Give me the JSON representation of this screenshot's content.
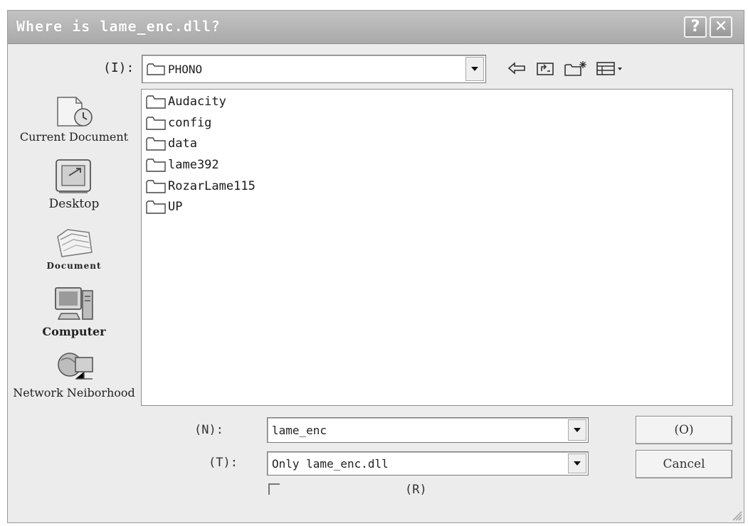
{
  "window": {
    "title": "Where is lame_enc.dll?",
    "help_glyph": "?",
    "close_glyph": "✕"
  },
  "look_in": {
    "label": "(I):",
    "value": "PHONO"
  },
  "toolbar": {
    "icons": [
      "back-arrow-icon",
      "up-folder-icon",
      "new-folder-icon",
      "view-menu-icon"
    ]
  },
  "places": [
    {
      "label": "Current Document",
      "icon": "recent-documents-icon"
    },
    {
      "label": "Desktop",
      "icon": "desktop-icon"
    },
    {
      "label": "Document",
      "icon": "my-documents-icon"
    },
    {
      "label": "Computer",
      "icon": "computer-icon"
    },
    {
      "label": "Network Neiborhood",
      "icon": "network-icon"
    }
  ],
  "files": [
    {
      "name": "Audacity"
    },
    {
      "name": "config"
    },
    {
      "name": "data"
    },
    {
      "name": "lame392"
    },
    {
      "name": "RozarLame115"
    },
    {
      "name": "UP"
    }
  ],
  "filename": {
    "label": "(N):",
    "value": "lame_enc"
  },
  "filetype": {
    "label": "(T):",
    "value": "Only lame_enc.dll"
  },
  "buttons": {
    "open_label": "(O)",
    "cancel_label": "Cancel"
  },
  "readonly": {
    "label": "(R)"
  },
  "colors": {
    "titlebar": "#b3b3b3",
    "dialog_bg": "#ececec",
    "folder_stroke": "#444444"
  }
}
